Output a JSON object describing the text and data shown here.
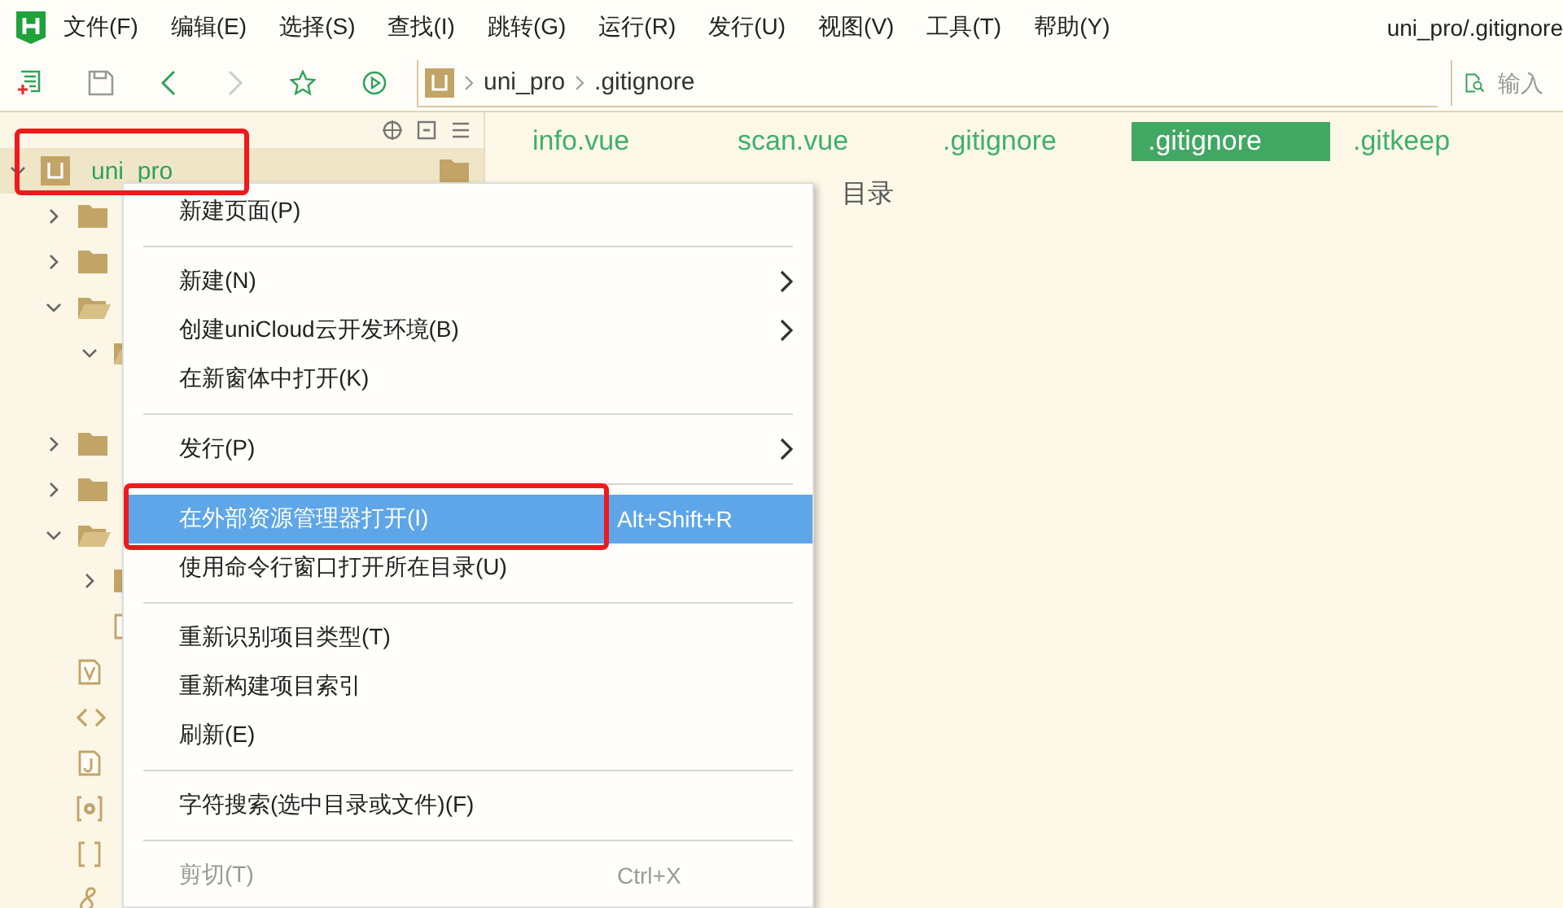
{
  "menubar": {
    "items": [
      "文件(F)",
      "编辑(E)",
      "选择(S)",
      "查找(I)",
      "跳转(G)",
      "运行(R)",
      "发行(U)",
      "视图(V)",
      "工具(T)",
      "帮助(Y)"
    ]
  },
  "window": {
    "title": "uni_pro/.gitignore"
  },
  "toolbar": {
    "breadcrumb": [
      "uni_pro",
      ".gitignore"
    ],
    "search": {
      "placeholder": "输入"
    }
  },
  "tree": {
    "root": {
      "label": "uni_pro",
      "expanded": true,
      "selected": true,
      "children": [
        {
          "kind": "folder",
          "expanded": false
        },
        {
          "kind": "folder",
          "expanded": false
        },
        {
          "kind": "folder",
          "expanded": true,
          "children": [
            {
              "kind": "folder",
              "expanded": true
            }
          ]
        },
        {
          "kind": "folder",
          "expanded": false
        },
        {
          "kind": "folder",
          "expanded": false
        },
        {
          "kind": "folder",
          "expanded": true,
          "children": [
            {
              "kind": "folder",
              "expanded": false
            },
            {
              "kind": "file"
            }
          ]
        },
        {
          "kind": "vue"
        },
        {
          "kind": "html"
        },
        {
          "kind": "js"
        },
        {
          "kind": "config"
        },
        {
          "kind": "json"
        },
        {
          "kind": "script"
        }
      ]
    }
  },
  "tabs": [
    {
      "label": "info.vue",
      "selected": false
    },
    {
      "label": "scan.vue",
      "selected": false
    },
    {
      "label": ".gitignore",
      "selected": false
    },
    {
      "label": ".gitignore",
      "selected": true
    },
    {
      "label": ".gitkeep",
      "selected": false
    }
  ],
  "editor": {
    "text": "目录"
  },
  "context_menu": [
    {
      "kind": "item",
      "label": "新建页面(P)",
      "selected": false,
      "disabled": false,
      "submenu": false
    },
    {
      "kind": "separator"
    },
    {
      "kind": "item",
      "label": "新建(N)",
      "selected": false,
      "disabled": false,
      "submenu": true
    },
    {
      "kind": "item",
      "label": "创建uniCloud云开发环境(B)",
      "selected": false,
      "disabled": false,
      "submenu": true
    },
    {
      "kind": "item",
      "label": "在新窗体中打开(K)",
      "selected": false,
      "disabled": false,
      "submenu": false
    },
    {
      "kind": "separator"
    },
    {
      "kind": "item",
      "label": "发行(P)",
      "selected": false,
      "disabled": false,
      "submenu": true
    },
    {
      "kind": "separator"
    },
    {
      "kind": "item",
      "label": "在外部资源管理器打开(I)",
      "shortcut": "Alt+Shift+R",
      "selected": true,
      "disabled": false,
      "submenu": false
    },
    {
      "kind": "item",
      "label": "使用命令行窗口打开所在目录(U)",
      "selected": false,
      "disabled": false,
      "submenu": false
    },
    {
      "kind": "separator"
    },
    {
      "kind": "item",
      "label": "重新识别项目类型(T)",
      "selected": false,
      "disabled": false,
      "submenu": false
    },
    {
      "kind": "item",
      "label": "重新构建项目索引",
      "selected": false,
      "disabled": false,
      "submenu": false
    },
    {
      "kind": "item",
      "label": "刷新(E)",
      "selected": false,
      "disabled": false,
      "submenu": false
    },
    {
      "kind": "separator"
    },
    {
      "kind": "item",
      "label": "字符搜索(选中目录或文件)(F)",
      "selected": false,
      "disabled": false,
      "submenu": false
    },
    {
      "kind": "separator"
    },
    {
      "kind": "item",
      "label": "剪切(T)",
      "shortcut": "Ctrl+X",
      "selected": false,
      "disabled": true,
      "submenu": false
    }
  ]
}
